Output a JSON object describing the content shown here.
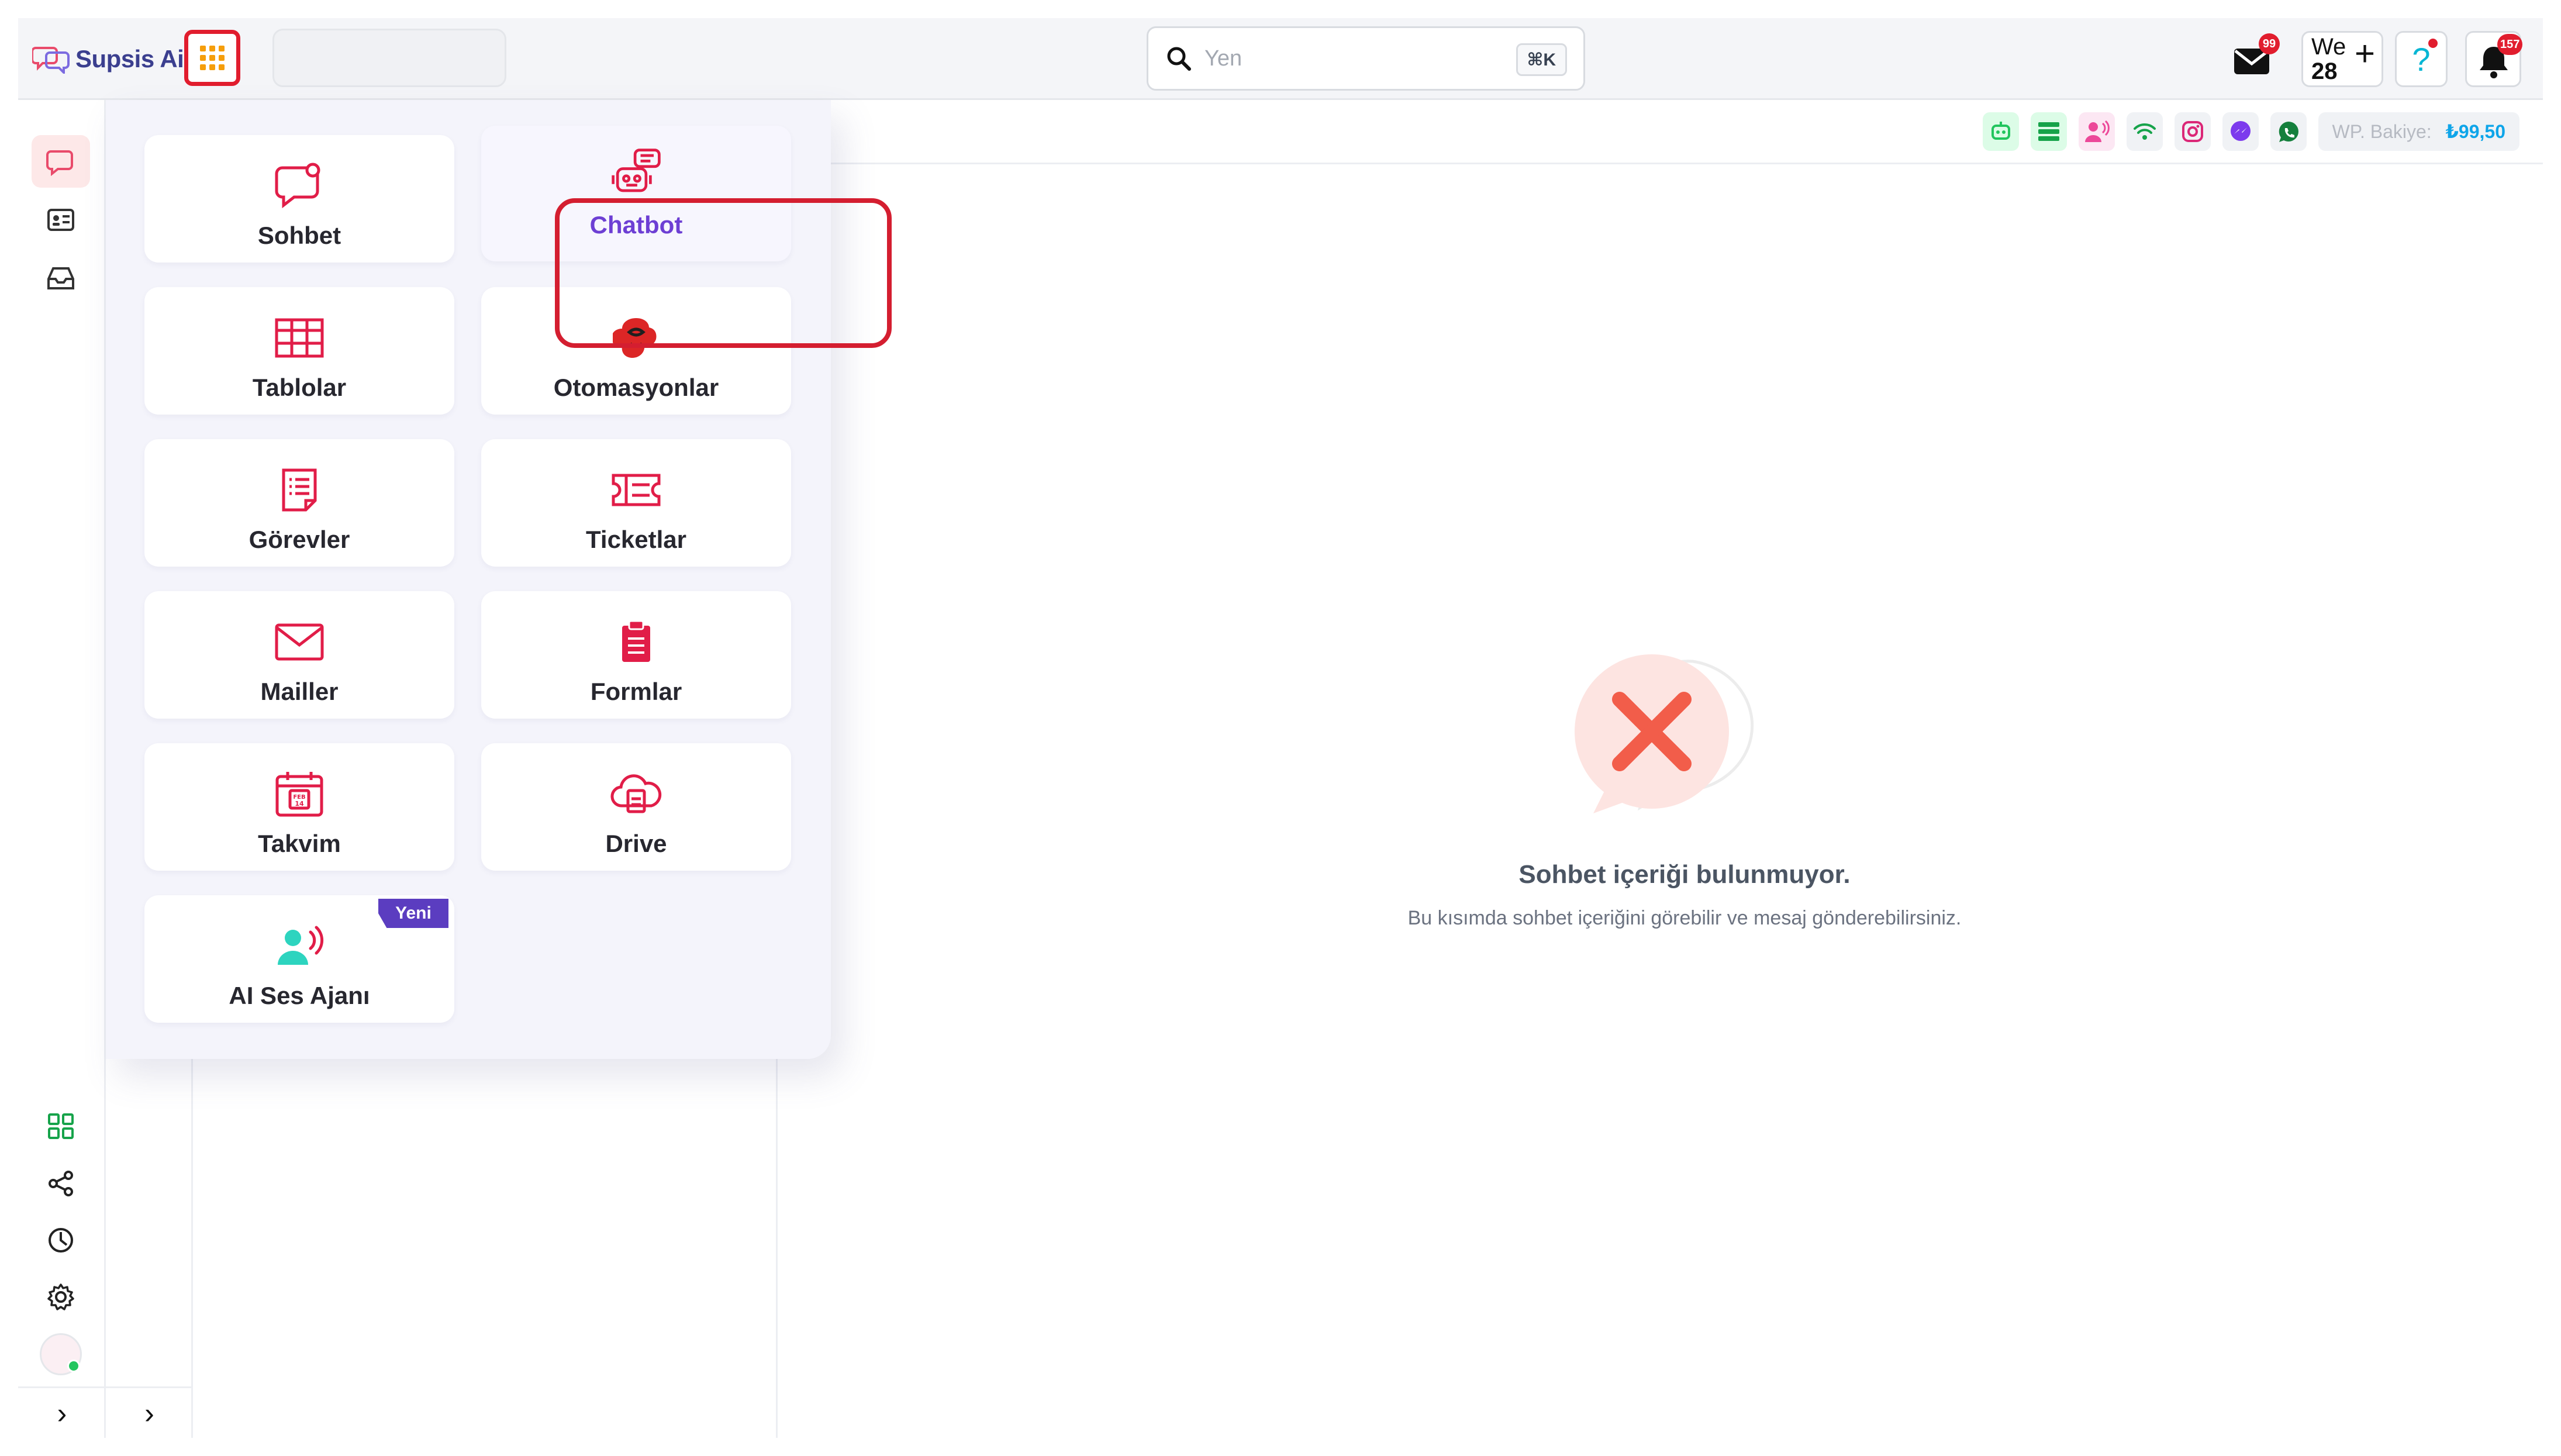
{
  "brand": {
    "name": "Supsis Ai"
  },
  "search": {
    "placeholder": "Yen",
    "shortcut": "⌘K"
  },
  "header": {
    "mail_badge": "99",
    "workspace_short": "We",
    "workspace_num": "28",
    "help_icon": "?",
    "bell_badge": "157"
  },
  "channels": {
    "balance_label": "WP. Bakiye:",
    "balance_value": "₺99,50",
    "icons": [
      "bot-icon",
      "list-icon",
      "voice-agent-icon",
      "wifi-icon",
      "instagram-icon",
      "messenger-icon",
      "whatsapp-icon"
    ]
  },
  "launcher": {
    "tiles": [
      {
        "label": "Sohbet",
        "icon": "chat-bubble-icon"
      },
      {
        "label": "Chatbot",
        "icon": "chatbot-robot-icon",
        "selected": true
      },
      {
        "label": "Tablolar",
        "icon": "table-icon"
      },
      {
        "label": "Otomasyonlar",
        "icon": "automation-icon"
      },
      {
        "label": "Görevler",
        "icon": "task-list-icon"
      },
      {
        "label": "Ticketlar",
        "icon": "ticket-icon"
      },
      {
        "label": "Mailler",
        "icon": "mail-icon"
      },
      {
        "label": "Formlar",
        "icon": "clipboard-icon"
      },
      {
        "label": "Takvim",
        "icon": "calendar-icon"
      },
      {
        "label": "Drive",
        "icon": "cloud-drive-icon"
      },
      {
        "label": "AI Ses Ajanı",
        "icon": "voice-agent-icon",
        "tag": "Yeni"
      }
    ]
  },
  "empty_state": {
    "title": "Sohbet içeriği bulunmuyor.",
    "subtitle": "Bu kısımda sohbet içeriğini görebilir ve mesaj gönderebilirsiniz."
  },
  "sidebar": {
    "expand_icon": "›"
  },
  "colors": {
    "brand_red": "#e11d2e",
    "accent_purple": "#6d3fd4",
    "balance_blue": "#0ea5e9"
  }
}
